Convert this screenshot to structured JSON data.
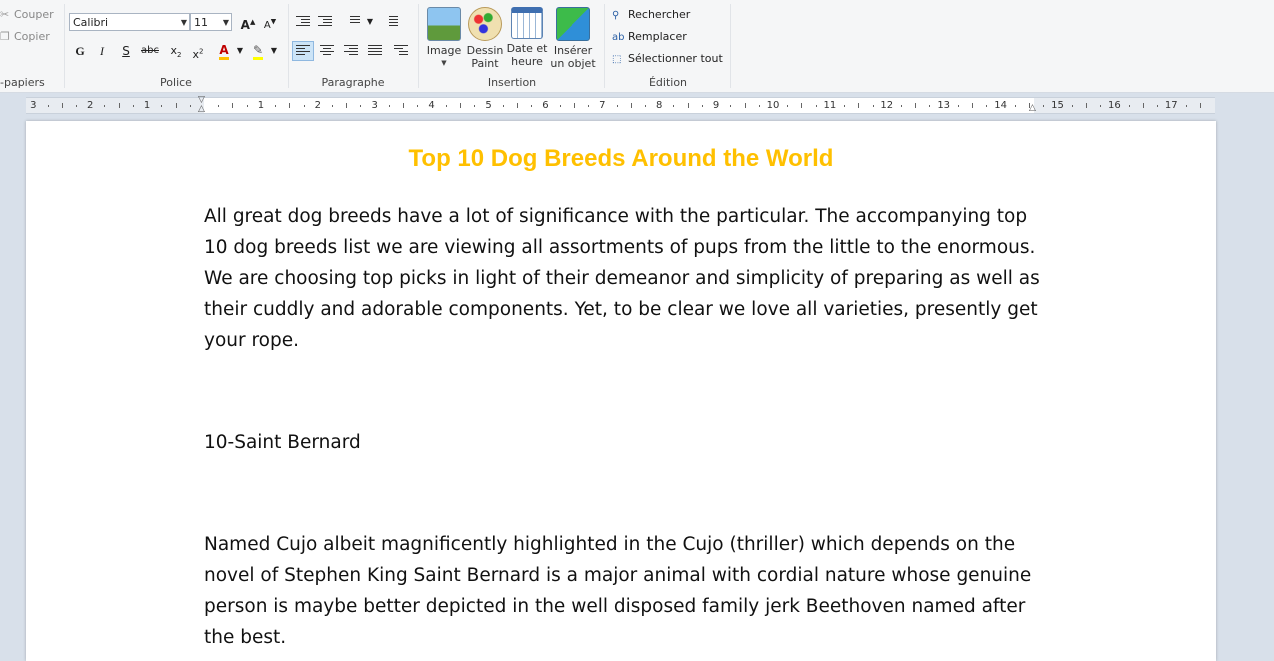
{
  "ribbon": {
    "clipboard": {
      "cut_label": "Couper",
      "copy_label": "Copier",
      "group_label": "-papiers"
    },
    "font": {
      "font_name": "Calibri",
      "font_size": "11",
      "group_label": "Police"
    },
    "paragraph": {
      "group_label": "Paragraphe"
    },
    "insertion": {
      "group_label": "Insertion",
      "image_label": "Image",
      "paint_label_1": "Dessin",
      "paint_label_2": "Paint",
      "date_label_1": "Date et",
      "date_label_2": "heure",
      "object_label_1": "Insérer",
      "object_label_2": "un objet"
    },
    "editing": {
      "group_label": "Édition",
      "find_label": "Rechercher",
      "replace_label": "Remplacer",
      "select_all_label": "Sélectionner tout"
    }
  },
  "ruler": {
    "numbers_left": [
      "3",
      "2",
      "1"
    ],
    "numbers_right": [
      "1",
      "2",
      "3",
      "4",
      "5",
      "6",
      "7",
      "8",
      "9",
      "10",
      "11",
      "12",
      "13",
      "14",
      "15",
      "16",
      "17"
    ]
  },
  "document": {
    "title": "Top 10 Dog Breeds Around the World",
    "title_color": "#ffc000",
    "para1": "All great dog breeds have a lot of significance with the particular. The accompanying top 10 dog breeds list we are viewing all assortments of pups from the little to the enormous. We are choosing top picks in light of their demeanor and simplicity of preparing as well as their cuddly and adorable components. Yet, to be clear we love all varieties, presently get your rope.",
    "heading2": "10-Saint Bernard",
    "para2": "Named Cujo albeit magnificently highlighted in the Cujo (thriller) which depends on the novel of Stephen King Saint Bernard is a major animal with cordial nature whose genuine person is maybe better depicted in the well disposed family jerk Beethoven named after the best."
  }
}
